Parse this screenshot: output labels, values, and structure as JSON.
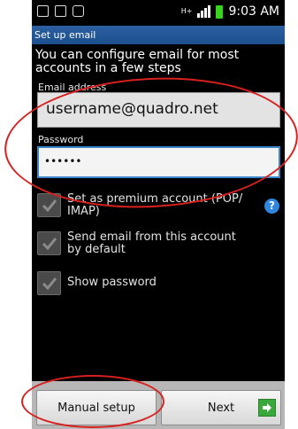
{
  "status_bar": {
    "time": "9:03 AM",
    "network": "H+",
    "icons": [
      "missed-call-icon",
      "mail-icon",
      "photo-icon"
    ]
  },
  "screen": {
    "title": "Set up email"
  },
  "intro": "You can configure email for most accounts in a few steps",
  "email": {
    "label": "Email address",
    "value": "username@quadro.net"
  },
  "password": {
    "label": "Password",
    "value": "••••••"
  },
  "options": [
    {
      "label": "Set as premium account (POP/ IMAP)",
      "checked": true
    },
    {
      "label": "Send email from this account by default",
      "checked": true
    },
    {
      "label": "Show password",
      "checked": true
    }
  ],
  "help_label": "?",
  "buttons": {
    "manual": "Manual setup",
    "next": "Next"
  },
  "colors": {
    "title_bar": "#2b5fa0",
    "focus_border": "#3c87c9",
    "annotation": "#d9201e",
    "next_arrow": "#3aa83a"
  }
}
